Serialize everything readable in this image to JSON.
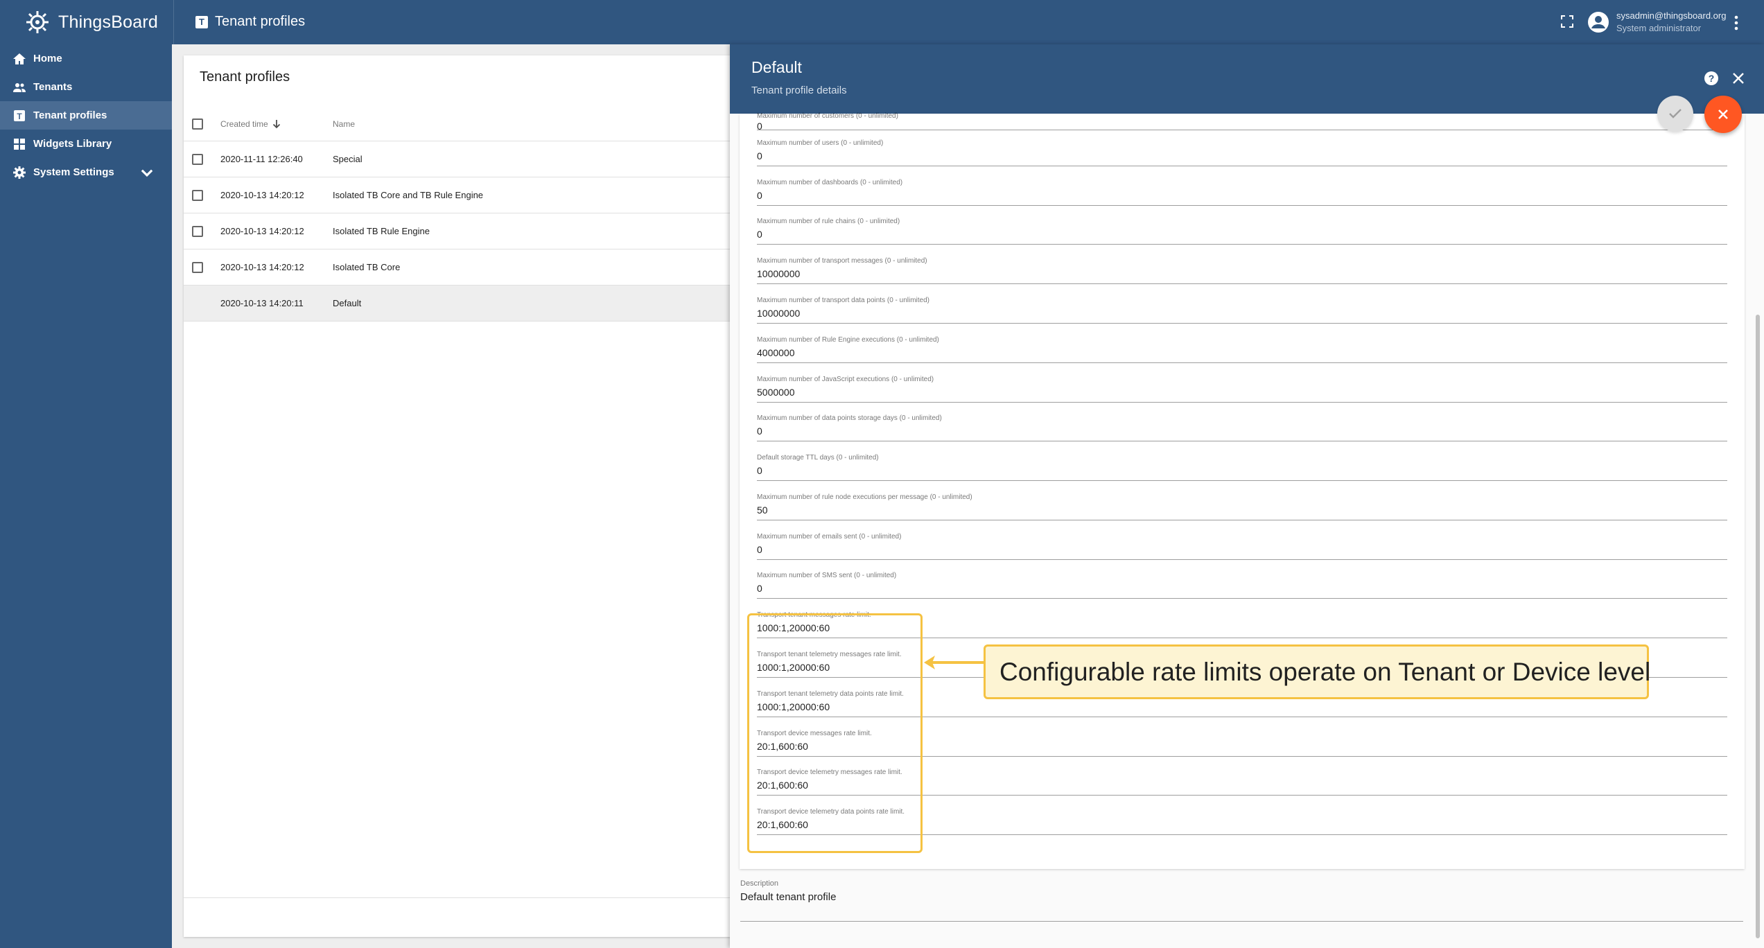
{
  "app": {
    "name": "ThingsBoard",
    "page_title": "Tenant profiles",
    "user": {
      "email": "sysadmin@thingsboard.org",
      "role": "System administrator"
    }
  },
  "sidebar": {
    "items": [
      {
        "label": "Home",
        "icon": "home-icon"
      },
      {
        "label": "Tenants",
        "icon": "people-icon"
      },
      {
        "label": "Tenant profiles",
        "icon": "tenant-profile-icon",
        "active": true
      },
      {
        "label": "Widgets Library",
        "icon": "widgets-icon"
      },
      {
        "label": "System Settings",
        "icon": "gear-icon",
        "expandable": true
      }
    ]
  },
  "list": {
    "title": "Tenant profiles",
    "columns": {
      "created": "Created time",
      "name": "Name"
    },
    "rows": [
      {
        "created": "2020-11-11 12:26:40",
        "name": "Special"
      },
      {
        "created": "2020-10-13 14:20:12",
        "name": "Isolated TB Core and TB Rule Engine"
      },
      {
        "created": "2020-10-13 14:20:12",
        "name": "Isolated TB Rule Engine"
      },
      {
        "created": "2020-10-13 14:20:12",
        "name": "Isolated TB Core"
      },
      {
        "created": "2020-10-13 14:20:11",
        "name": "Default",
        "selected": true
      }
    ]
  },
  "details": {
    "title": "Default",
    "subtitle": "Tenant profile details",
    "fields": [
      {
        "label": "Maximum number of customers (0 - unlimited)",
        "value": "0"
      },
      {
        "label": "Maximum number of users (0 - unlimited)",
        "value": "0"
      },
      {
        "label": "Maximum number of dashboards (0 - unlimited)",
        "value": "0"
      },
      {
        "label": "Maximum number of rule chains (0 - unlimited)",
        "value": "0"
      },
      {
        "label": "Maximum number of transport messages (0 - unlimited)",
        "value": "10000000"
      },
      {
        "label": "Maximum number of transport data points (0 - unlimited)",
        "value": "10000000"
      },
      {
        "label": "Maximum number of Rule Engine executions (0 - unlimited)",
        "value": "4000000"
      },
      {
        "label": "Maximum number of JavaScript executions (0 - unlimited)",
        "value": "5000000"
      },
      {
        "label": "Maximum number of data points storage days (0 - unlimited)",
        "value": "0"
      },
      {
        "label": "Default storage TTL days (0 - unlimited)",
        "value": "0"
      },
      {
        "label": "Maximum number of rule node executions per message (0 - unlimited)",
        "value": "50"
      },
      {
        "label": "Maximum number of emails sent (0 - unlimited)",
        "value": "0"
      },
      {
        "label": "Maximum number of SMS sent (0 - unlimited)",
        "value": "0"
      },
      {
        "label": "Transport tenant messages rate limit.",
        "value": "1000:1,20000:60"
      },
      {
        "label": "Transport tenant telemetry messages rate limit.",
        "value": "1000:1,20000:60"
      },
      {
        "label": "Transport tenant telemetry data points rate limit.",
        "value": "1000:1,20000:60"
      },
      {
        "label": "Transport device messages rate limit.",
        "value": "20:1,600:60"
      },
      {
        "label": "Transport device telemetry messages rate limit.",
        "value": "20:1,600:60"
      },
      {
        "label": "Transport device telemetry data points rate limit.",
        "value": "20:1,600:60"
      }
    ],
    "description": {
      "label": "Description",
      "value": "Default tenant profile"
    }
  },
  "annotation": {
    "callout": "Configurable rate limits operate on Tenant or Device level",
    "color": "#f5c242"
  },
  "colors": {
    "primary": "#305680",
    "accent": "#ff5722"
  }
}
